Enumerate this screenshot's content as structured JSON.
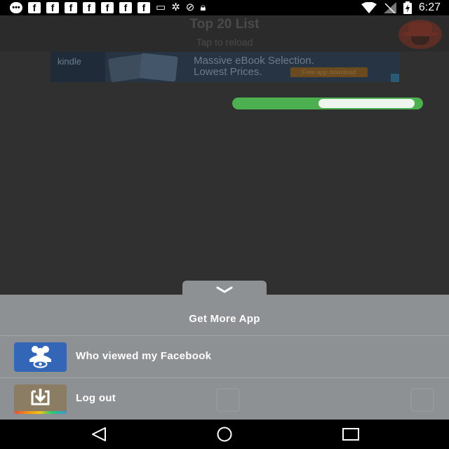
{
  "status_bar": {
    "notification_icons": [
      "chat-icon",
      "facebook-icon",
      "facebook-icon",
      "facebook-icon",
      "facebook-icon",
      "facebook-icon",
      "facebook-icon",
      "facebook-icon",
      "card-icon",
      "fan-icon",
      "blocked-icon",
      "lock-icon"
    ],
    "fb_glyph": "f",
    "time": "6:27"
  },
  "header": {
    "title": "Top 20 List",
    "subtitle": "Tap to reload"
  },
  "ad": {
    "brand": "kindle",
    "line1": "Massive eBook Selection.",
    "line2": "Lowest Prices.",
    "button": "Free app download"
  },
  "loader": {
    "progress": 0.47
  },
  "sheet": {
    "title": "Get More App",
    "items": [
      {
        "label": "Who viewed my Facebook"
      },
      {
        "label": "Log out"
      }
    ]
  },
  "colors": {
    "accent_green": "#4caf50",
    "sheet_bg": "#8e9193",
    "facebook_blue": "#3466b8"
  }
}
